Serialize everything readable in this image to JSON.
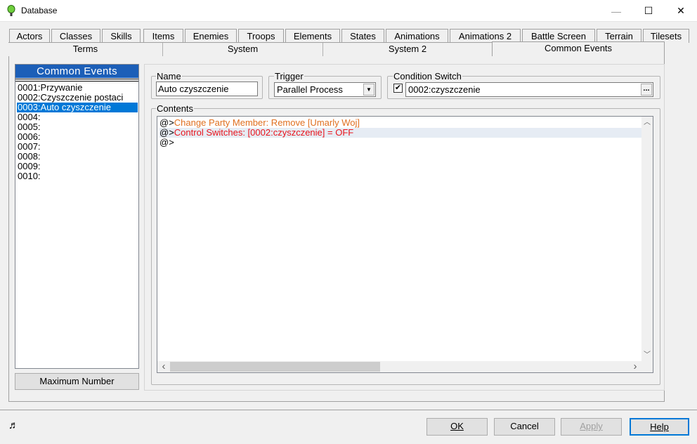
{
  "window": {
    "title": "Database",
    "minimize_glyph": "—",
    "maximize_glyph": "☐",
    "close_glyph": "✕"
  },
  "tabs_row1": [
    "Actors",
    "Classes",
    "Skills",
    "Items",
    "Enemies",
    "Troops",
    "Elements",
    "States",
    "Animations",
    "Animations 2",
    "Battle Screen",
    "Terrain",
    "Tilesets"
  ],
  "tabs_row2": [
    "Terms",
    "System",
    "System 2",
    "Common Events"
  ],
  "active_tab": "Common Events",
  "list": {
    "header": "Common Events",
    "items": [
      "0001:Przywanie",
      "0002:Czyszczenie postaci",
      "0003:Auto czyszczenie",
      "0004:",
      "0005:",
      "0006:",
      "0007:",
      "0008:",
      "0009:",
      "0010:"
    ],
    "selected_index": 2,
    "max_number_label": "Maximum Number"
  },
  "name": {
    "label": "Name",
    "value": "Auto czyszczenie"
  },
  "trigger": {
    "label": "Trigger",
    "value": "Parallel Process",
    "arrow_glyph": "▼"
  },
  "condition_switch": {
    "label": "Condition Switch",
    "checked": true,
    "check_glyph": "✔",
    "value": "0002:czyszczenie",
    "browse_glyph": "..."
  },
  "contents": {
    "label": "Contents",
    "lines": [
      {
        "prefix": "@>",
        "text": "Change Party Member: Remove [Umarly Woj]",
        "color": "#e07020"
      },
      {
        "prefix": "@>",
        "text": "Control Switches: [0002:czyszczenie] = OFF",
        "color": "#e8141c"
      },
      {
        "prefix": "@>",
        "text": "",
        "color": "#000000"
      }
    ],
    "highlighted_line": 1
  },
  "scroll_glyphs": {
    "up": "︿",
    "down": "﹀",
    "left": "‹",
    "right": "›"
  },
  "buttons": {
    "ok": "OK",
    "cancel": "Cancel",
    "apply": "Apply",
    "help": "Help"
  },
  "status_icon": "♬"
}
